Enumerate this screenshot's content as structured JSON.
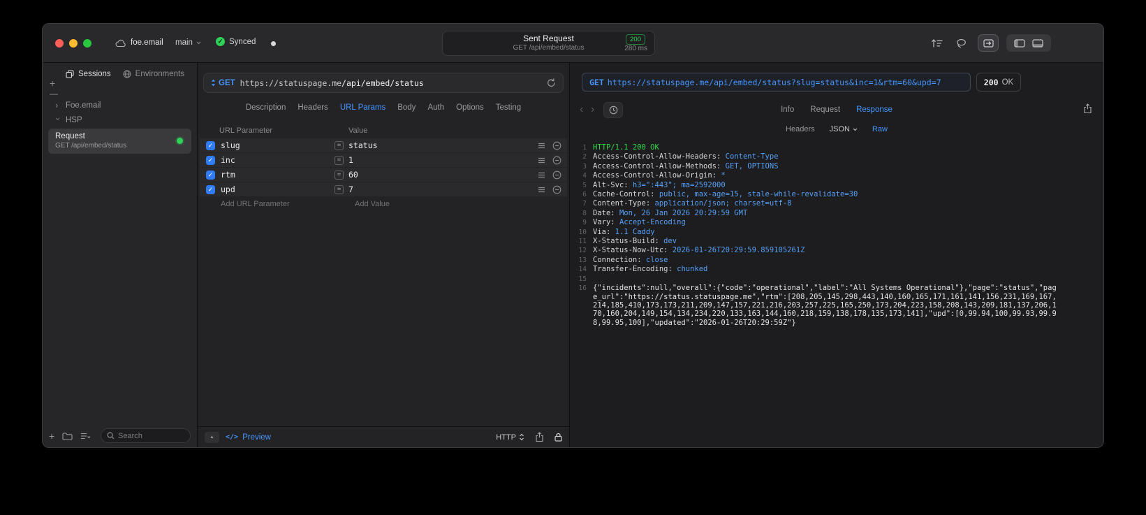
{
  "colors": {
    "accent_blue": "#4596ff",
    "success_green": "#30d158",
    "header_value_blue": "#55a0f8"
  },
  "titlebar": {
    "project": "foe.email",
    "branch": "main",
    "sync": "Synced",
    "activity": {
      "title": "Sent Request",
      "code": "200",
      "subtitle": "GET /api/embed/status",
      "duration": "280 ms"
    }
  },
  "sidebar": {
    "tabs": {
      "sessions": "Sessions",
      "environments": "Environments"
    },
    "groups": {
      "foe_email": "Foe.email",
      "hsp": "HSP"
    },
    "request": {
      "title": "Request",
      "subtitle": "GET /api/embed/status"
    },
    "search_placeholder": "Search"
  },
  "request": {
    "method": "GET",
    "url_host": "https://statuspage.me",
    "url_path": "/api/embed/status",
    "tabs": [
      "Description",
      "Headers",
      "URL Params",
      "Body",
      "Auth",
      "Options",
      "Testing"
    ],
    "params": {
      "col_param": "URL Parameter",
      "col_value": "Value",
      "rows": [
        {
          "name": "slug",
          "value": "status"
        },
        {
          "name": "inc",
          "value": "1"
        },
        {
          "name": "rtm",
          "value": "60"
        },
        {
          "name": "upd",
          "value": "7"
        }
      ],
      "add_param": "Add URL Parameter",
      "add_value": "Add Value"
    },
    "footer": {
      "code_glyph": "</>",
      "preview": "Preview",
      "protocol": "HTTP"
    }
  },
  "response": {
    "method": "GET",
    "url": "https://statuspage.me/api/embed/status?slug=status&inc=1&rtm=60&upd=7",
    "status_code": "200",
    "status_text": "OK",
    "tabs": [
      "Info",
      "Request",
      "Response"
    ],
    "subtabs": [
      "Headers",
      "JSON",
      "Raw"
    ],
    "code": {
      "status_ln": "1",
      "status_line": "HTTP/1.1 200 OK",
      "headers": [
        {
          "ln": "2",
          "name": "Access-Control-Allow-Headers:",
          "value": "Content-Type"
        },
        {
          "ln": "3",
          "name": "Access-Control-Allow-Methods:",
          "value": "GET, OPTIONS"
        },
        {
          "ln": "4",
          "name": "Access-Control-Allow-Origin:",
          "value": "*"
        },
        {
          "ln": "5",
          "name": "Alt-Svc:",
          "value": "h3=\":443\"; ma=2592000"
        },
        {
          "ln": "6",
          "name": "Cache-Control:",
          "value": "public, max-age=15, stale-while-revalidate=30"
        },
        {
          "ln": "7",
          "name": "Content-Type:",
          "value": "application/json; charset=utf-8"
        },
        {
          "ln": "8",
          "name": "Date:",
          "value": "Mon, 26 Jan 2026 20:29:59 GMT"
        },
        {
          "ln": "9",
          "name": "Vary:",
          "value": "Accept-Encoding"
        },
        {
          "ln": "10",
          "name": "Via:",
          "value": "1.1 Caddy"
        },
        {
          "ln": "11",
          "name": "X-Status-Build:",
          "value": "dev"
        },
        {
          "ln": "12",
          "name": "X-Status-Now-Utc:",
          "value": "2026-01-26T20:29:59.859105261Z"
        },
        {
          "ln": "13",
          "name": "Connection:",
          "value": "close"
        },
        {
          "ln": "14",
          "name": "Transfer-Encoding:",
          "value": "chunked"
        }
      ],
      "blank_ln": "15",
      "body_ln": "16",
      "body": "{\"incidents\":null,\"overall\":{\"code\":\"operational\",\"label\":\"All Systems Operational\"},\"page\":\"status\",\"page_url\":\"https://status.statuspage.me\",\"rtm\":[208,205,145,298,443,140,160,165,171,161,141,156,231,169,167,214,185,410,173,173,211,209,147,157,221,216,203,257,225,165,250,173,204,223,158,208,143,209,181,137,206,170,160,204,149,154,134,234,220,133,163,144,160,218,159,138,178,135,173,141],\"upd\":[0,99.94,100,99.93,99.98,99.95,100],\"updated\":\"2026-01-26T20:29:59Z\"}"
    }
  }
}
